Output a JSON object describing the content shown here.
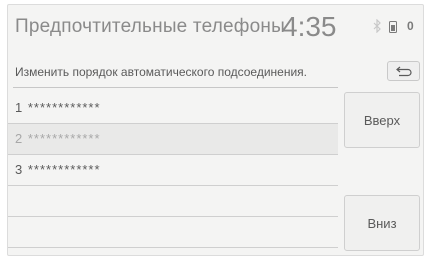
{
  "header": {
    "title": "Предпочтительные телефоны",
    "time": "4:35",
    "status": {
      "bluetooth_icon": "bluetooth-icon",
      "phone_icon": "phone-battery-icon",
      "message_count": "0"
    }
  },
  "instruction": "Изменить порядок автоматического подсоединения.",
  "back_icon": "return-arrow-icon",
  "phones": [
    {
      "label": "1 ************",
      "selected": false
    },
    {
      "label": "2 ************",
      "selected": true
    },
    {
      "label": "3 ************",
      "selected": false
    }
  ],
  "buttons": {
    "up": "Вверх",
    "down": "Вниз"
  }
}
